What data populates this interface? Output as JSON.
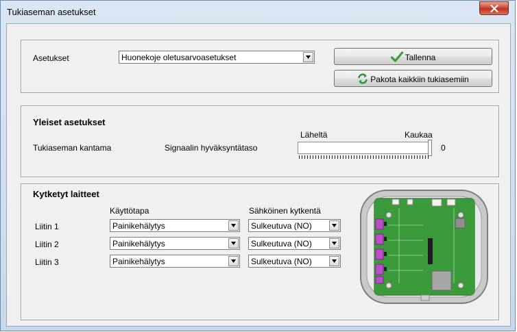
{
  "window": {
    "title": "Tukiaseman asetukset"
  },
  "top": {
    "settings_label": "Asetukset",
    "settings_value": "Huonekoje oletusarvoasetukset",
    "save_label": "Tallenna",
    "force_label": "Pakota kaikkiin tukiasemiin"
  },
  "general": {
    "title": "Yleiset asetukset",
    "range_label": "Tukiaseman kantama",
    "threshold_label": "Signaalin hyväksyntätaso",
    "near_label": "Läheltä",
    "far_label": "Kaukaa",
    "slider_value": "0",
    "slider_fraction": 1.0
  },
  "devices": {
    "title": "Kytketyt laitteet",
    "mode_header": "Käyttötapa",
    "electrical_header": "Sähköinen kytkentä",
    "rows": [
      {
        "label": "Liitin 1",
        "mode": "Painikehälytys",
        "contact": "Sulkeutuva (NO)"
      },
      {
        "label": "Liitin 2",
        "mode": "Painikehälytys",
        "contact": "Sulkeutuva (NO)"
      },
      {
        "label": "Liitin 3",
        "mode": "Painikehälytys",
        "contact": "Sulkeutuva (NO)"
      }
    ]
  },
  "icons": {
    "save": "checkmark-icon",
    "force": "sync-icon",
    "close": "close-icon",
    "dropdown": "chevron-down-icon"
  },
  "colors": {
    "close_button": "#c9442c",
    "checkmark": "#3aa12e",
    "sync": "#2f9a3a",
    "pcb": "#3b9b3b",
    "connector": "#b84fc6"
  }
}
